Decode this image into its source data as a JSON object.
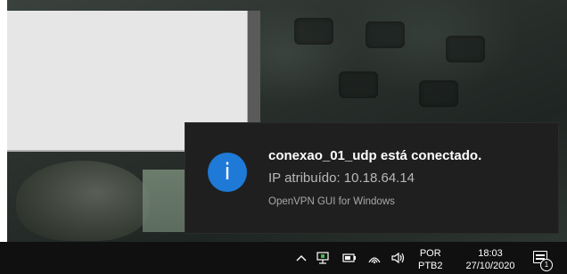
{
  "toast": {
    "icon": "info-icon",
    "icon_glyph": "i",
    "title": "conexao_01_udp está conectado.",
    "body": "IP atribuído: 10.18.64.14",
    "attribution": "OpenVPN GUI for Windows",
    "accent_color": "#1e7ad6"
  },
  "taskbar": {
    "tray_icons": [
      "chevron-up-icon",
      "network-icon",
      "battery-icon",
      "pen-icon",
      "volume-icon"
    ],
    "language": "POR",
    "layout": "PTB2",
    "time": "18:03",
    "date": "27/10/2020",
    "notification_count": "1"
  }
}
